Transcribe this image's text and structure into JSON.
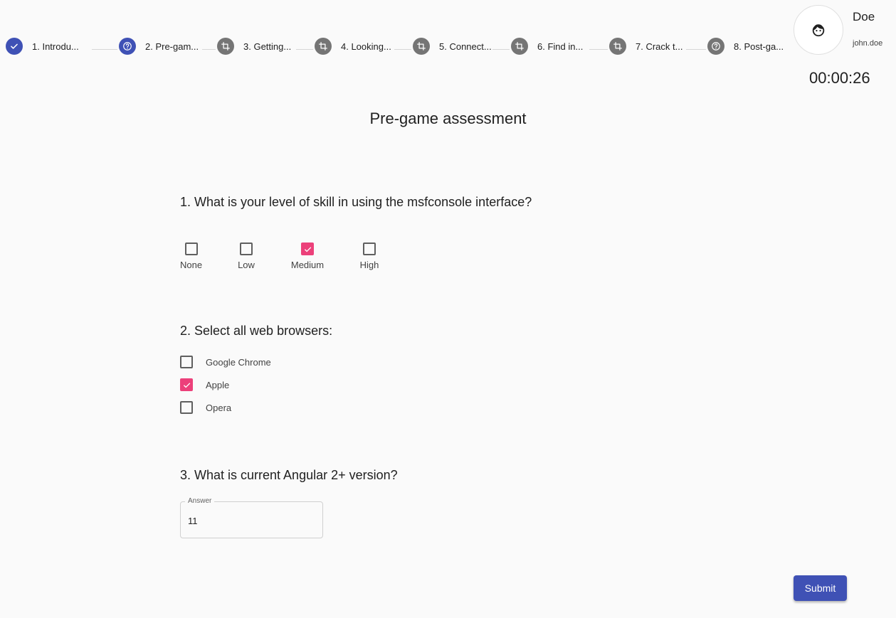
{
  "stepper": {
    "steps": [
      {
        "label": "1. Introdu...",
        "status": "done",
        "icon": "check-icon"
      },
      {
        "label": "2. Pre-gam...",
        "status": "active",
        "icon": "question-icon"
      },
      {
        "label": "3. Getting...",
        "status": "pending",
        "icon": "crop-icon"
      },
      {
        "label": "4. Looking...",
        "status": "pending",
        "icon": "crop-icon"
      },
      {
        "label": "5. Connect...",
        "status": "pending",
        "icon": "crop-icon"
      },
      {
        "label": "6. Find in...",
        "status": "pending",
        "icon": "crop-icon"
      },
      {
        "label": "7. Crack t...",
        "status": "pending",
        "icon": "crop-icon"
      },
      {
        "label": "8. Post-ga...",
        "status": "pending",
        "icon": "question-icon"
      }
    ]
  },
  "user": {
    "name": "Doe",
    "login": "john.doe",
    "avatar_icon": "user-face-icon"
  },
  "timer": "00:00:26",
  "page_title": "Pre-game assessment",
  "questions": {
    "q1": {
      "text": "1. What is your level of skill in using the msfconsole interface?",
      "options": [
        {
          "label": "None",
          "checked": false
        },
        {
          "label": "Low",
          "checked": false
        },
        {
          "label": "Medium",
          "checked": true
        },
        {
          "label": "High",
          "checked": false
        }
      ]
    },
    "q2": {
      "text": "2. Select all web browsers:",
      "options": [
        {
          "label": "Google Chrome",
          "checked": false
        },
        {
          "label": "Apple",
          "checked": true
        },
        {
          "label": "Opera",
          "checked": false
        }
      ]
    },
    "q3": {
      "text": "3. What is current Angular 2+ version?",
      "answer_label": "Answer",
      "answer_value": "11"
    }
  },
  "submit_label": "Submit",
  "colors": {
    "primary": "#3f51b5",
    "accent": "#ec407a",
    "pending": "#757575",
    "background": "#fafafa"
  }
}
